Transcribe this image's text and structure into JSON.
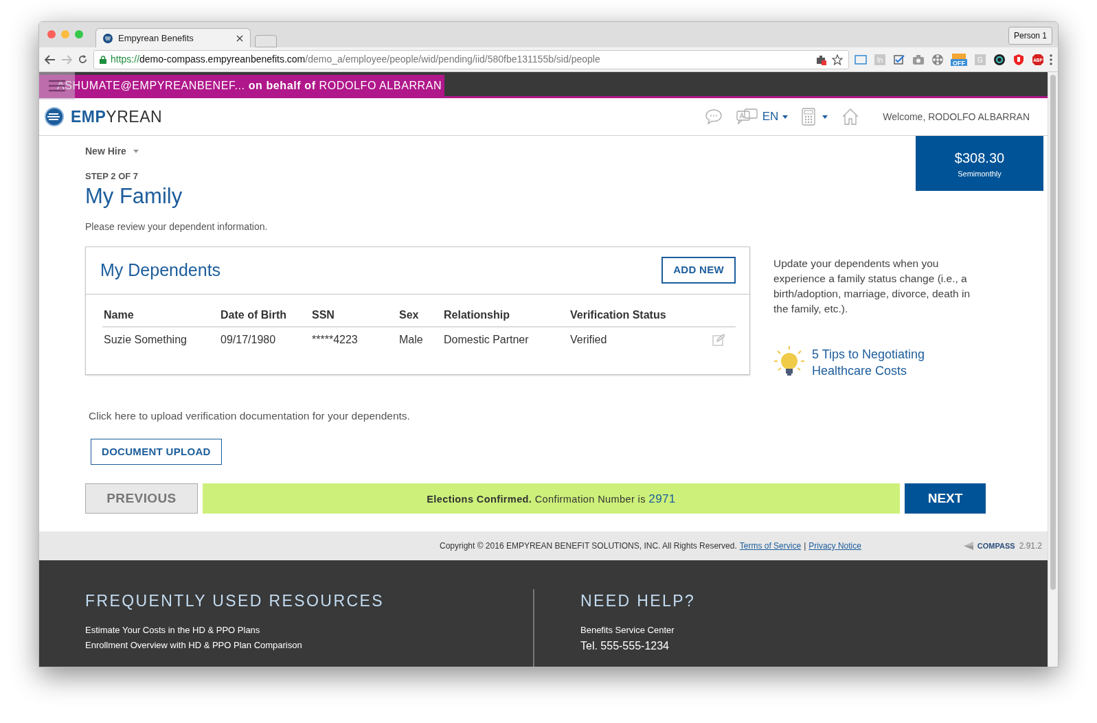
{
  "browser": {
    "tab_title": "Empyrean Benefits",
    "profile": "Person 1",
    "url_scheme": "https://",
    "url_host": "demo-compass.empyreanbenefits.com",
    "url_path": "/demo_a/employee/people/wid/pending/iid/580fbe131155b/sid/people",
    "extensions": [
      {
        "kind": "frame"
      },
      {
        "kind": "tile",
        "label": "In"
      },
      {
        "kind": "check"
      },
      {
        "kind": "camera"
      },
      {
        "kind": "reel"
      },
      {
        "kind": "badge",
        "label": "OFF"
      },
      {
        "kind": "tile",
        "label": "G"
      },
      {
        "kind": "ring"
      },
      {
        "kind": "shield"
      },
      {
        "kind": "stop",
        "label": "ABP"
      }
    ]
  },
  "impersonation": {
    "user": "ASHUMATE@EMPYREANBENEF...",
    "connector": "on behalf of",
    "target": "RODOLFO ALBARRAN"
  },
  "header": {
    "logo": "**EMP**YREAN",
    "language": "EN",
    "welcome": "Welcome, RODOLFO ALBARRAN"
  },
  "cost": {
    "amount": "$308.30",
    "period": "Semimonthly"
  },
  "flow": {
    "name": "New Hire",
    "step": "STEP 2 OF 7"
  },
  "page": {
    "title": "My Family",
    "subtitle": "Please review your dependent information."
  },
  "dependents": {
    "title": "My Dependents",
    "add_button": "ADD NEW",
    "columns": [
      "Name",
      "Date of Birth",
      "SSN",
      "Sex",
      "Relationship",
      "Verification Status"
    ],
    "rows": [
      {
        "cells": [
          "Suzie Something",
          "09/17/1980",
          "*****4223",
          "Male",
          "Domestic Partner",
          "Verified"
        ],
        "editable": true
      }
    ]
  },
  "sidebar": {
    "note": "Update your dependents when you experience a family status change (i.e., a birth/adoption, marriage, divorce, death in the family, etc.).",
    "tip_link": "5 Tips to Negotiating Healthcare Costs"
  },
  "upload": {
    "prompt": "Click here to upload verification documentation for your dependents.",
    "button": "DOCUMENT UPLOAD"
  },
  "navigation": {
    "previous": "PREVIOUS",
    "message": "**Elections Confirmed.** Confirmation Number is",
    "confirmation_number": "2971",
    "next": "NEXT"
  },
  "legal": {
    "copyright": "Copyright © 2016 EMPYREAN BENEFIT SOLUTIONS, INC. All Rights Reserved.",
    "links": [
      "Terms of Service",
      "Privacy Notice"
    ],
    "separator": "|",
    "product": "COMPASS",
    "version": "2.91.2"
  },
  "resources": {
    "title": "FREQUENTLY USED RESOURCES",
    "items": [
      "Estimate Your Costs in the HD & PPO Plans",
      "Enrollment Overview with HD & PPO Plan Comparison"
    ]
  },
  "help": {
    "title": "NEED HELP?",
    "lines": [
      {
        "text": "Benefits Service Center",
        "kind": "label"
      },
      {
        "text": "Tel. 555-555-1234",
        "kind": "phone"
      }
    ]
  }
}
